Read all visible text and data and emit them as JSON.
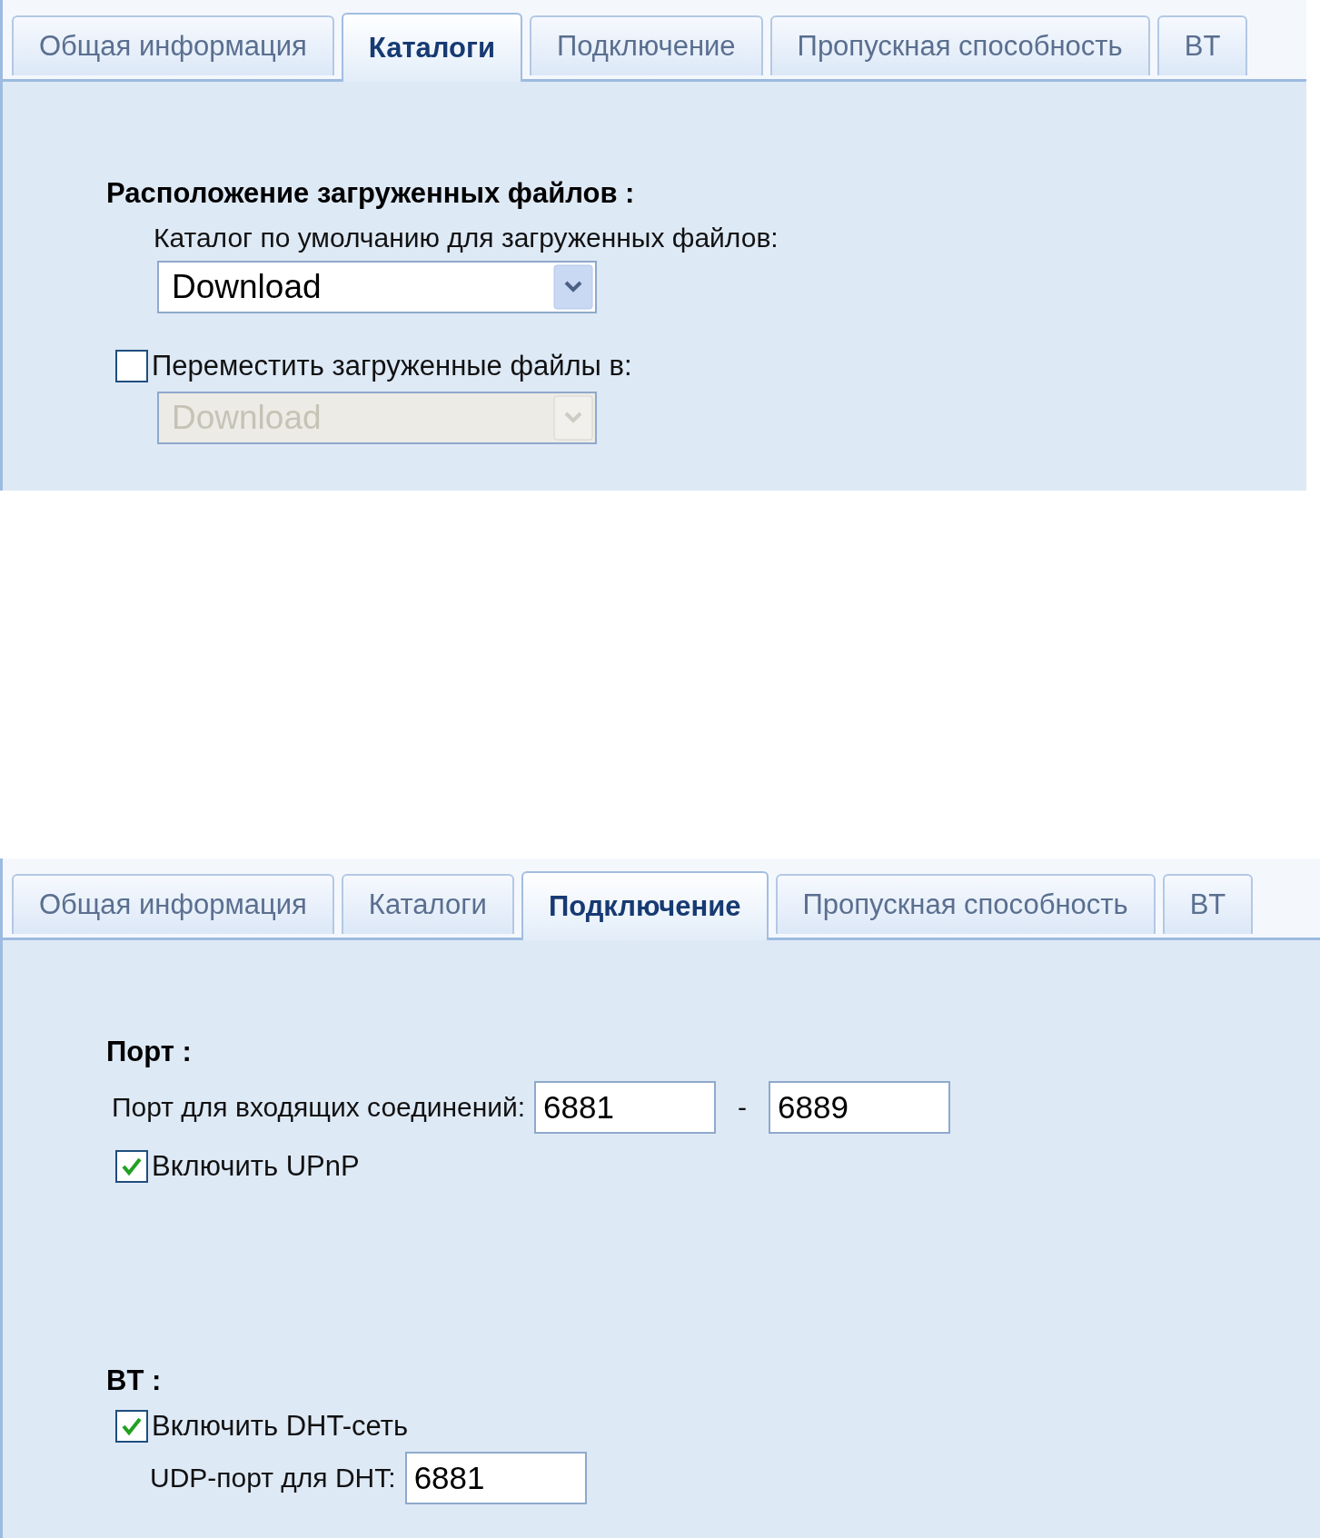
{
  "panels": [
    {
      "tabs": [
        {
          "label": "Общая информация",
          "selected": false
        },
        {
          "label": "Каталоги",
          "selected": true
        },
        {
          "label": "Подключение",
          "selected": false
        },
        {
          "label": "Пропускная способность",
          "selected": false
        },
        {
          "label": "BT",
          "selected": false
        }
      ],
      "sections": [
        {
          "heading": "Расположение загруженных файлов :",
          "items": [
            {
              "kind": "label",
              "text": "Каталог по умолчанию для загруженных файлов:"
            },
            {
              "kind": "dropdown",
              "value": "Download",
              "disabled": false
            },
            {
              "kind": "checkbox",
              "label": "Переместить загруженные файлы в:",
              "checked": false
            },
            {
              "kind": "dropdown",
              "value": "Download",
              "disabled": true
            }
          ]
        }
      ]
    },
    {
      "tabs": [
        {
          "label": "Общая информация",
          "selected": false
        },
        {
          "label": "Каталоги",
          "selected": false
        },
        {
          "label": "Подключение",
          "selected": true
        },
        {
          "label": "Пропускная способность",
          "selected": false
        },
        {
          "label": "BT",
          "selected": false
        }
      ],
      "sections": [
        {
          "heading": "Порт :",
          "items": [
            {
              "kind": "port_range",
              "label": "Порт для входящих соединений:",
              "from": "6881",
              "separator": "-",
              "to": "6889"
            },
            {
              "kind": "checkbox",
              "label": "Включить UPnP",
              "checked": true
            }
          ]
        },
        {
          "heading": "BT :",
          "items": [
            {
              "kind": "checkbox",
              "label": "Включить DHT-сеть",
              "checked": true
            },
            {
              "kind": "field",
              "label": "UDP-порт для DHT:",
              "value": "6881"
            }
          ]
        }
      ]
    }
  ]
}
